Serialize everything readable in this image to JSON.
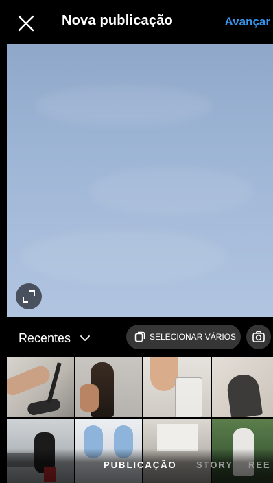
{
  "header": {
    "title": "Nova publicação",
    "next_label": "Avançar"
  },
  "preview": {
    "expand_icon": "expand-icon"
  },
  "gallery_toolbar": {
    "album_label": "Recentes",
    "multi_select_label": "SELECIONAR VÁRIOS",
    "camera_icon": "camera-icon"
  },
  "thumbnails": [
    "photo-feet-bicycle",
    "photo-woman-braids",
    "photo-drink-glass",
    "photo-shadow-wall",
    "photo-office-desk",
    "photo-airplane-window",
    "photo-room-interior",
    "photo-person-garden"
  ],
  "modes": {
    "post": "PUBLICAÇÃO",
    "story": "STORY",
    "reels": "REE"
  },
  "colors": {
    "accent": "#3797f0",
    "background": "#000000",
    "chip": "#363636"
  }
}
